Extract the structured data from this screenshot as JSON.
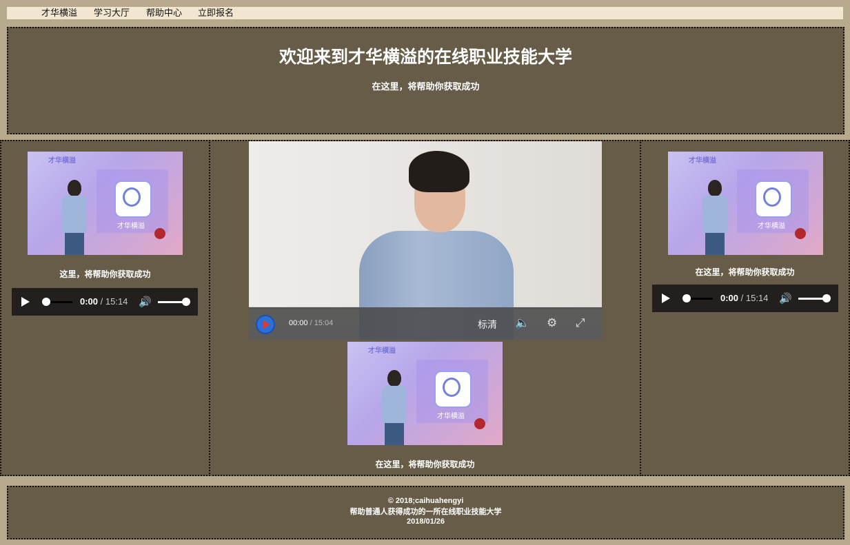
{
  "nav": {
    "items": [
      "才华横溢",
      "学习大厅",
      "帮助中心",
      "立即报名"
    ]
  },
  "hero": {
    "title": "欢迎来到才华横溢的在线职业技能大学",
    "subtitle": "在这里，将帮助你获取成功"
  },
  "left": {
    "thumb": {
      "logo": "才华横溢",
      "app_label": "才华横溢"
    },
    "caption": "这里，将帮助你获取成功",
    "audio": {
      "current": "0:00",
      "duration": "/ 15:14"
    }
  },
  "middle": {
    "video": {
      "current": "00:00",
      "duration": "/ 15:04",
      "quality": "标清"
    },
    "thumb": {
      "logo": "才华横溢",
      "app_label": "才华横溢"
    },
    "caption": "在这里，将帮助你获取成功"
  },
  "right": {
    "thumb": {
      "logo": "才华横溢",
      "app_label": "才华横溢"
    },
    "caption": "在这里，将帮助你获取成功",
    "audio": {
      "current": "0:00",
      "duration": "/ 15:14"
    }
  },
  "footer": {
    "line1": "© 2018;caihuahengyi",
    "line2": "帮助普通人获得成功的一所在线职业技能大学",
    "line3": "2018/01/26"
  },
  "colors": {
    "page_bg": "#b6a98c",
    "nav_bg": "#f2e6d1",
    "panel_bg": "#665c48",
    "player_bg": "#221f1c"
  }
}
